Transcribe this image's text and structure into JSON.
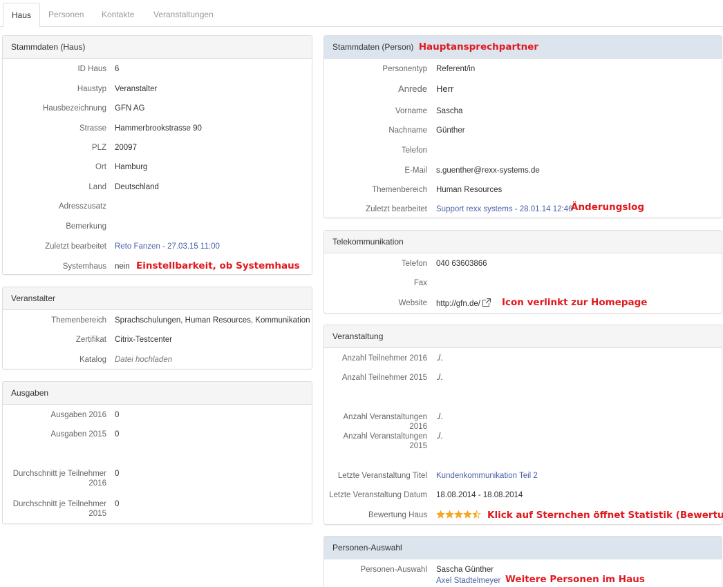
{
  "tabs": [
    {
      "label": "Haus",
      "active": true
    },
    {
      "label": "Personen",
      "active": false
    },
    {
      "label": "Kontakte",
      "active": false
    },
    {
      "label": "Veranstaltungen",
      "active": false
    }
  ],
  "stammdaten_haus": {
    "title": "Stammdaten (Haus)",
    "rows": [
      {
        "label": "ID Haus",
        "value": "6"
      },
      {
        "label": "Haustyp",
        "value": "Veranstalter"
      },
      {
        "label": "Hausbezeichnung",
        "value": "GFN AG"
      },
      {
        "label": "Strasse",
        "value": "Hammerbrookstrasse 90"
      },
      {
        "label": "PLZ",
        "value": "20097"
      },
      {
        "label": "Ort",
        "value": "Hamburg"
      },
      {
        "label": "Land",
        "value": "Deutschland"
      },
      {
        "label": "Adresszusatz",
        "value": ""
      },
      {
        "label": "Bemerkung",
        "value": ""
      },
      {
        "label": "Zuletzt bearbeitet",
        "value": "Reto Fanzen - 27.03.15 11:00"
      },
      {
        "label": "Systemhaus",
        "value": "nein"
      }
    ],
    "note": "Einstellbarkeit, ob Systemhaus"
  },
  "veranstalter": {
    "title": "Veranstalter",
    "rows": [
      {
        "label": "Themenbereich",
        "value": "Sprachschulungen, Human Resources, Kommunikation"
      },
      {
        "label": "Zertifikat",
        "value": "Citrix-Testcenter"
      },
      {
        "label": "Katalog",
        "value": "Datei hochladen"
      }
    ]
  },
  "ausgaben": {
    "title": "Ausgaben",
    "rows": [
      {
        "label": "Ausgaben 2016",
        "value": "0"
      },
      {
        "label": "Ausgaben 2015",
        "value": "0"
      },
      {
        "label_line1": "Durchschnitt je Teilnehmer",
        "label_line2": "2016",
        "value": "0"
      },
      {
        "label_line1": "Durchschnitt je Teilnehmer",
        "label_line2": "2015",
        "value": "0"
      }
    ]
  },
  "stammdaten_person": {
    "title": "Stammdaten (Person)",
    "title_note": "Hauptansprechpartner",
    "rows": [
      {
        "label": "Personentyp",
        "value": "Referent/in"
      },
      {
        "label": "Anrede",
        "value": "Herr"
      },
      {
        "label": "Vorname",
        "value": "Sascha"
      },
      {
        "label": "Nachname",
        "value": "Günther"
      },
      {
        "label": "Telefon",
        "value": ""
      },
      {
        "label": "E-Mail",
        "value": "s.guenther@rexx-systems.de"
      },
      {
        "label": "Themenbereich",
        "value": "Human Resources"
      },
      {
        "label": "Zuletzt bearbeitet",
        "value": "Support rexx systems - 28.01.14 12:46"
      }
    ],
    "note": "Änderungslog"
  },
  "telekommunikation": {
    "title": "Telekommunikation",
    "rows": [
      {
        "label": "Telefon",
        "value": "040 63603866"
      },
      {
        "label": "Fax",
        "value": ""
      },
      {
        "label": "Website",
        "value": "http://gfn.de/"
      }
    ],
    "note": "Icon verlinkt zur Homepage"
  },
  "veranstaltung": {
    "title": "Veranstaltung",
    "rows": [
      {
        "label": "Anzahl Teilnehmer 2016",
        "value": "./."
      },
      {
        "label": "Anzahl Teilnehmer 2015",
        "value": "./."
      },
      {
        "label": "Anzahl Veranstaltungen 2016",
        "value": "./."
      },
      {
        "label": "Anzahl Veranstaltungen 2015",
        "value": "./."
      },
      {
        "label": "Letzte Veranstaltung Titel",
        "value": "Kundenkommunikation Teil 2"
      },
      {
        "label": "Letzte Veranstaltung Datum",
        "value": "18.08.2014 - 18.08.2014"
      },
      {
        "label": "Bewertung Haus",
        "value": ""
      }
    ],
    "rating": 4.5,
    "rating_max": 5,
    "star_color": "#f5a623",
    "note": "Klick auf Sternchen öffnet Statistik (Bewertung)"
  },
  "personen_auswahl": {
    "title": "Personen-Auswahl",
    "label": "Personen-Auswahl",
    "persons": [
      "Sascha Günther",
      "Axel Stadtelmeyer"
    ],
    "note": "Weitere Personen im Haus"
  },
  "colors": {
    "annotation": "#e0191e",
    "link": "#4a5fa8",
    "header_blue": "#dce4ee",
    "header_grey": "#f5f5f5"
  }
}
